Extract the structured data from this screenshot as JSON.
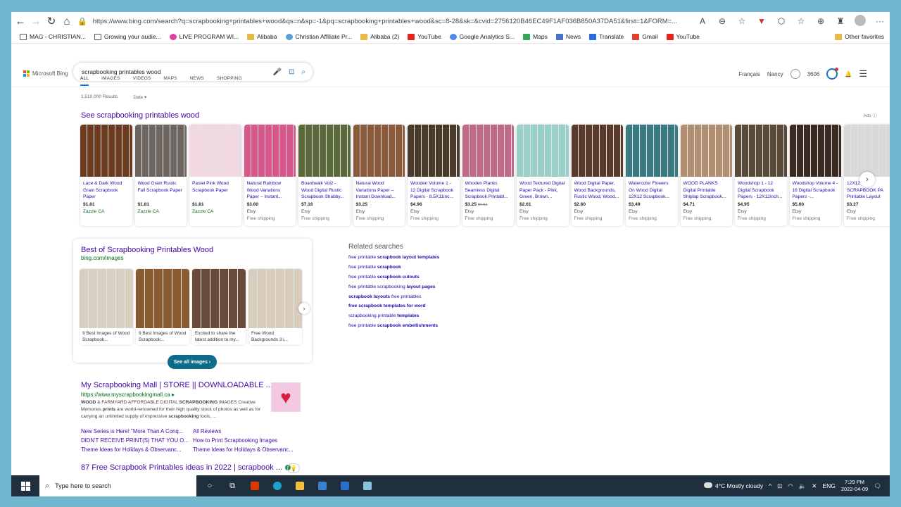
{
  "browser": {
    "url": "https://www.bing.com/search?q=scrapbooking+printables+wood&qs=n&sp=-1&pq=scrapbooking+printables+wood&sc=8-28&sk=&cvid=2756120B46EC49F1AF036B850A37DA51&first=1&FORM=...",
    "bookmarks": [
      "MAG - CHRISTIAN...",
      "Growing your audie...",
      "LIVE PROGRAM WI...",
      "Alibaba",
      "Christian Affiliate Pr...",
      "Alibaba (2)",
      "YouTube",
      "Google Analytics S...",
      "Maps",
      "News",
      "Translate",
      "Gmail",
      "YouTube"
    ],
    "other_favorites": "Other favorites"
  },
  "bing": {
    "logo": "Microsoft Bing",
    "query": "scrapbooking printables wood",
    "language": "Français",
    "user": "Nancy",
    "points": "3606",
    "tabs": [
      "ALL",
      "IMAGES",
      "VIDEOS",
      "MAPS",
      "NEWS",
      "SHOPPING"
    ],
    "results_count": "1,510,000 Results",
    "date_filter": "Date ▾"
  },
  "shopping": {
    "title": "See scrapbooking printables wood",
    "ads_label": "Ads",
    "products": [
      {
        "title": "Lace & Dark Wood Grain Scrapbook Paper",
        "price": "$1.81",
        "old": "",
        "seller": "Zazzle CA",
        "ship": "",
        "color": "#6b3a1f"
      },
      {
        "title": "Wood Grain Rustic Fall Scrapbook Paper",
        "price": "$1.81",
        "old": "",
        "seller": "Zazzle CA",
        "ship": "",
        "color": "#6d6560"
      },
      {
        "title": "Pastel Pink Wood Scrapbook Paper",
        "price": "$1.81",
        "old": "",
        "seller": "Zazzle CA",
        "ship": "",
        "color": "#f2d8e2"
      },
      {
        "title": "Natural Rainbow Wood Variations Paper – Instant...",
        "price": "$3.60",
        "old": "",
        "seller": "Etsy",
        "ship": "Free shipping",
        "color": "#d9568a"
      },
      {
        "title": "Boardwalk Vol2 - Wood Digital Rustic Scrapbook Shabby...",
        "price": "$7.16",
        "old": "",
        "seller": "Etsy",
        "ship": "Free shipping",
        "color": "#5a6a3a"
      },
      {
        "title": "Natural Wood Variations Paper – Instant Download...",
        "price": "$3.25",
        "old": "",
        "seller": "Etsy",
        "ship": "Free shipping",
        "color": "#8a5a3a"
      },
      {
        "title": "Wooden Volume 1 - 12 Digital Scrapbook Papers - 8.5X11inc...",
        "price": "$4.96",
        "old": "",
        "seller": "Etsy",
        "ship": "Free shipping",
        "color": "#4a3a2a"
      },
      {
        "title": "Wooden Planks Seamless Digital Scrapbook Printabl...",
        "price": "$3.25",
        "old": "$6.51",
        "seller": "Etsy",
        "ship": "Free shipping",
        "color": "#c06a8a"
      },
      {
        "title": "Wood Textured Digital Paper Pack - Pink, Green, Brown...",
        "price": "$2.61",
        "old": "",
        "seller": "Etsy",
        "ship": "Free shipping",
        "color": "#9ad0c8"
      },
      {
        "title": "Wood Digital Paper, Wood Backgrounds, Rustic Wood, Wood...",
        "price": "$2.60",
        "old": "",
        "seller": "Etsy",
        "ship": "Free shipping",
        "color": "#5a3a2a"
      },
      {
        "title": "Watercolor Flowers On Wood Digital 12X12 Scrapbook...",
        "price": "$3.49",
        "old": "",
        "seller": "Etsy",
        "ship": "Free shipping",
        "color": "#3a7a80"
      },
      {
        "title": "WOOD PLANKS Digital Printable Shiplap Scrapbook...",
        "price": "$4.71",
        "old": "",
        "seller": "Etsy",
        "ship": "Free shipping",
        "color": "#b09070"
      },
      {
        "title": "Woodshop 1 - 12 Digital Scrapbook Papers - 12X12inch...",
        "price": "$4.95",
        "old": "",
        "seller": "Etsy",
        "ship": "Free shipping",
        "color": "#5a4a3a"
      },
      {
        "title": "Woodshop Volume 4 - 16 Digital Scrapbook Papers -...",
        "price": "$5.60",
        "old": "",
        "seller": "Etsy",
        "ship": "Free shipping",
        "color": "#3a2a22"
      },
      {
        "title": "12X12 ADI SCRAPBOOK PA Printable Layout",
        "price": "$3.27",
        "old": "",
        "seller": "Etsy",
        "ship": "Free shipping",
        "color": "#d8d8d8"
      }
    ]
  },
  "images_panel": {
    "title": "Best of Scrapbooking Printables Wood",
    "source": "bing.com/images",
    "thumbs": [
      {
        "caption": "9 Best Images of Wood Scrapbook...",
        "color": "#d9cfc0"
      },
      {
        "caption": "9 Best Images of Wood Scrapbook...",
        "color": "#8a5a30"
      },
      {
        "caption": "Excited to share the latest addition to my...",
        "color": "#6a4a3a"
      },
      {
        "caption": "Free Wood Backgrounds 3 i...",
        "color": "#d8ccbc"
      }
    ],
    "see_all": "See all images"
  },
  "related": {
    "title": "Related searches",
    "items": [
      [
        [
          "free ",
          false
        ],
        [
          "printable ",
          false
        ],
        [
          "scrapbook layout templates",
          true
        ]
      ],
      [
        [
          "free ",
          false
        ],
        [
          "printable ",
          false
        ],
        [
          "scrapbook",
          true
        ]
      ],
      [
        [
          "free ",
          false
        ],
        [
          "printable ",
          false
        ],
        [
          "scrapbook cutouts",
          true
        ]
      ],
      [
        [
          "free ",
          false
        ],
        [
          "printable ",
          false
        ],
        [
          "scrapbooking ",
          false
        ],
        [
          "layout pages",
          true
        ]
      ],
      [
        [
          "scrapbook layouts ",
          true
        ],
        [
          "free ",
          false
        ],
        [
          "printables",
          false
        ]
      ],
      [
        [
          "free scrapbook templates for word",
          true
        ]
      ],
      [
        [
          "scrapbooking ",
          false
        ],
        [
          "printable ",
          false
        ],
        [
          "templates",
          true
        ]
      ],
      [
        [
          "free ",
          false
        ],
        [
          "printable ",
          false
        ],
        [
          "scrapbook embellishments",
          true
        ]
      ]
    ]
  },
  "result1": {
    "title": "My Scrapbooking Mall | STORE || DOWNLOADABLE ...",
    "url": "https://www.myscrapbookingmall.ca ▸",
    "desc_html": "<b>WOOD</b> & FARMYARD AFFORDABLE DIGITAL <b>SCRAPBOOKING</b> IMAGES Creative Memories <b>prints</b> are world-renowned for their high quality stock of photos as well as for carrying an unlimited supply of impressive <b>scrapbooking</b> tools, ...",
    "sublinks": [
      "New Series is Here! \"More Than A Conq...",
      "All Reviews",
      "DIDN'T RECEIVE PRINT(S) THAT YOU O...",
      "How to Print Scrapbooking Images",
      "Theme Ideas for Holidays & Observanc...",
      "Theme Ideas for Holidays & Observanc..."
    ]
  },
  "result2": {
    "title": "87 Free Scrapbook Printables ideas in 2022 | scrapbook ..."
  },
  "taskbar": {
    "search_placeholder": "Type here to search",
    "weather": "4°C  Mostly cloudy",
    "lang": "ENG",
    "time": "7:29 PM",
    "date": "2022-04-09"
  }
}
